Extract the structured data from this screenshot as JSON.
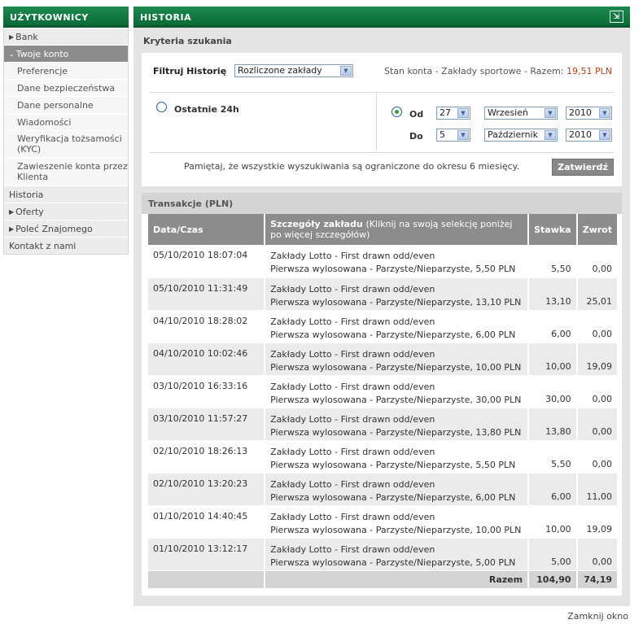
{
  "sidebar": {
    "title": "UŻYTKOWNICY",
    "items": [
      {
        "label": "Bank",
        "arrow": "▶"
      },
      {
        "label": "Twoje konto",
        "arrow": "⌄"
      },
      {
        "label": "Preferencje"
      },
      {
        "label": "Dane bezpieczeństwa"
      },
      {
        "label": "Dane personalne"
      },
      {
        "label": "Wiadomości"
      },
      {
        "label": "Weryfikacja tożsamości (KYC)"
      },
      {
        "label": "Zawieszenie konta przez Klienta"
      },
      {
        "label": "Historia"
      },
      {
        "label": "Oferty",
        "arrow": "▶"
      },
      {
        "label": "Poleć Znajomego",
        "arrow": "▶"
      },
      {
        "label": "Kontakt z nami"
      }
    ]
  },
  "main": {
    "title": "HISTORIA",
    "criteria_title": "Kryteria szukania",
    "filter_label": "Filtruj Historię",
    "filter_value": "Rozliczone zakłady",
    "balance_label": "Stan konta - Zakłady sportowe - Razem:",
    "balance_value": "19,51 PLN",
    "last24_label": "Ostatnie 24h",
    "from_label": "Od",
    "to_label": "Do",
    "from": {
      "day": "27",
      "month": "Wrzesień",
      "year": "2010"
    },
    "to": {
      "day": "5",
      "month": "Październik",
      "year": "2010"
    },
    "note": "Pamiętaj, że wszystkie wyszukiwania są ograniczone do okresu 6 miesięcy.",
    "submit_label": "Zatwierdź"
  },
  "transactions": {
    "title": "Transakcje (PLN)",
    "headers": {
      "date": "Data/Czas",
      "details": "Szczegóły zakładu",
      "details_hint": "(Kliknij na swoją selekcję poniżej po więcej szczegółów)",
      "stake": "Stawka",
      "return": "Zwrot"
    },
    "rows": [
      {
        "date": "05/10/2010 18:07:04",
        "line1": "Zakłady Lotto - First drawn odd/even",
        "line2": "Pierwsza wylosowana - Parzyste/Nieparzyste,  5,50 PLN",
        "stake": "5,50",
        "ret": "0,00"
      },
      {
        "date": "05/10/2010 11:31:49",
        "line1": "Zakłady Lotto - First drawn odd/even",
        "line2": "Pierwsza wylosowana - Parzyste/Nieparzyste,  13,10 PLN",
        "stake": "13,10",
        "ret": "25,01"
      },
      {
        "date": "04/10/2010 18:28:02",
        "line1": "Zakłady Lotto - First drawn odd/even",
        "line2": "Pierwsza wylosowana - Parzyste/Nieparzyste,  6,00 PLN",
        "stake": "6,00",
        "ret": "0,00"
      },
      {
        "date": "04/10/2010 10:02:46",
        "line1": "Zakłady Lotto - First drawn odd/even",
        "line2": "Pierwsza wylosowana - Parzyste/Nieparzyste,  10,00 PLN",
        "stake": "10,00",
        "ret": "19,09"
      },
      {
        "date": "03/10/2010 16:33:16",
        "line1": "Zakłady Lotto - First drawn odd/even",
        "line2": "Pierwsza wylosowana - Parzyste/Nieparzyste,  30,00 PLN",
        "stake": "30,00",
        "ret": "0,00"
      },
      {
        "date": "03/10/2010 11:57:27",
        "line1": "Zakłady Lotto - First drawn odd/even",
        "line2": "Pierwsza wylosowana - Parzyste/Nieparzyste,  13,80 PLN",
        "stake": "13,80",
        "ret": "0,00"
      },
      {
        "date": "02/10/2010 18:26:13",
        "line1": "Zakłady Lotto - First drawn odd/even",
        "line2": "Pierwsza wylosowana - Parzyste/Nieparzyste,  5,50 PLN",
        "stake": "5,50",
        "ret": "0,00"
      },
      {
        "date": "02/10/2010 13:20:23",
        "line1": "Zakłady Lotto - First drawn odd/even",
        "line2": "Pierwsza wylosowana - Parzyste/Nieparzyste,  6,00 PLN",
        "stake": "6,00",
        "ret": "11,00"
      },
      {
        "date": "01/10/2010 14:40:45",
        "line1": "Zakłady Lotto - First drawn odd/even",
        "line2": "Pierwsza wylosowana - Parzyste/Nieparzyste,  10,00 PLN",
        "stake": "10,00",
        "ret": "19,09"
      },
      {
        "date": "01/10/2010 13:12:17",
        "line1": "Zakłady Lotto - First drawn odd/even",
        "line2": "Pierwsza wylosowana - Parzyste/Nieparzyste,  5,00 PLN",
        "stake": "5,00",
        "ret": "0,00"
      }
    ],
    "total_label": "Razem",
    "total_stake": "104,90",
    "total_return": "74,19"
  },
  "close_label": "Zamknij okno"
}
